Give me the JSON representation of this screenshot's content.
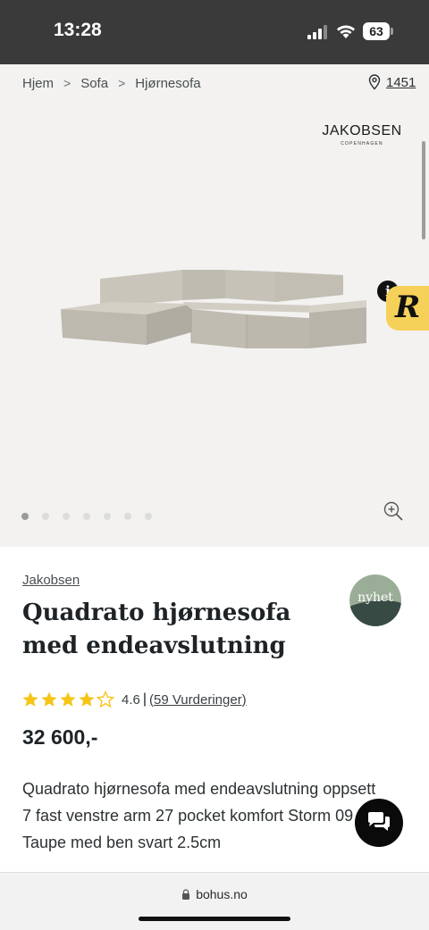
{
  "status_bar": {
    "time": "13:28",
    "battery": "63"
  },
  "breadcrumb": {
    "items": [
      "Hjem",
      "Sofa",
      "Hjørnesofa"
    ],
    "separator": ">"
  },
  "store": {
    "label": "1451",
    "icon": "location-pin-icon"
  },
  "brand_logo": {
    "name": "JAKOBSEN",
    "sub": "COPENHAGEN"
  },
  "gallery": {
    "slide_count": 7,
    "active_slide": 1
  },
  "badges": {
    "info": "i",
    "r_logo": "R",
    "new_label": "nyhet"
  },
  "product": {
    "brand": "Jakobsen",
    "title": "Quadrato hjørnesofa med endeavslutning",
    "rating_value": "4.6",
    "rating_stars": 4.6,
    "rating_separator": "|",
    "rating_count": "(59 Vurderinger)",
    "price": "32 600,-",
    "description": "Quadrato hjørnesofa med endeavslutning oppsett 7 fast venstre arm 27 pocket komfort Storm 09 Taupe med ben svart 2.5cm"
  },
  "browser": {
    "url": "bohus.no"
  },
  "colors": {
    "status_bar": "#3a3a3a",
    "gallery_bg": "#f3f2f1",
    "star": "#f5c518",
    "badge_yellow": "#f6d15a",
    "chat": "#0a0a0a"
  }
}
